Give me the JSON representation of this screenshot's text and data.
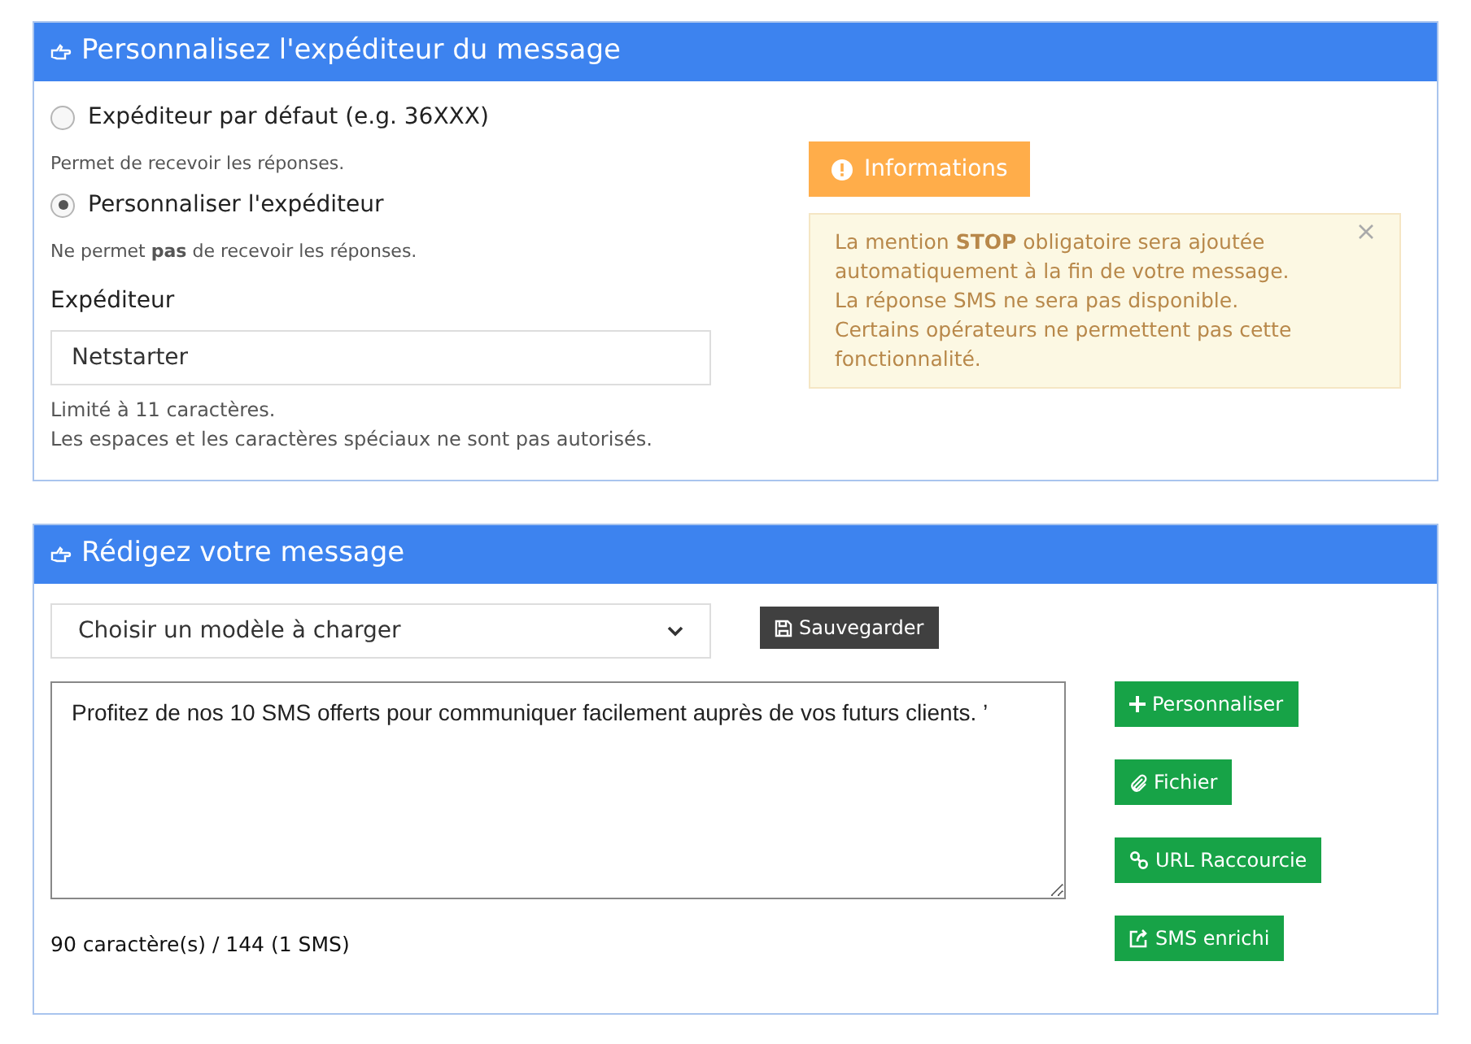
{
  "sender_panel": {
    "title": "Personnalisez l'expéditeur du message",
    "options": [
      {
        "label": "Expéditeur par défaut (e.g. 36XXX)",
        "hint": "Permet de recevoir les réponses.",
        "selected": false
      },
      {
        "label": "Personnaliser l'expéditeur",
        "hint": "Ne permet **pas** de recevoir les réponses.",
        "selected": true
      }
    ],
    "field": {
      "label": "Expéditeur",
      "value": "Netstarter",
      "help": [
        "Limité à 11 caractères.",
        "Les espaces et les caractères spéciaux ne sont pas autorisés."
      ]
    },
    "info_button": "Informations",
    "alert": {
      "lines": [
        "La mention **STOP** obligatoire sera ajoutée automatiquement à la fin de votre message.",
        "La réponse SMS ne sera pas disponible.",
        "Certains opérateurs ne permettent pas cette fonctionnalité."
      ]
    }
  },
  "message_panel": {
    "title": "Rédigez votre message",
    "template_select": "Choisir un modèle à charger",
    "save_button": "Sauvegarder",
    "message": "Profitez de nos 10 SMS offerts pour communiquer facilement auprès de vos futurs clients. ’",
    "counter": "90 caractère(s) / 144 (1 SMS)",
    "actions": [
      "Personnaliser",
      "Fichier",
      "URL Raccourcie",
      "SMS enrichi"
    ]
  }
}
